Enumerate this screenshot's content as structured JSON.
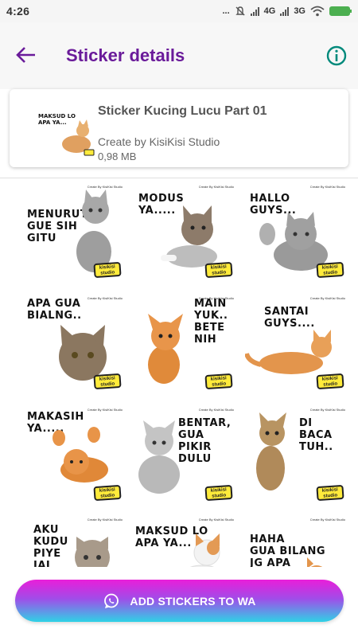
{
  "status_bar": {
    "time": "4:26",
    "dots": "...",
    "network_1": "4G",
    "network_2": "3G",
    "icons": [
      "dots-icon",
      "mute-icon",
      "signal-icon",
      "signal-icon",
      "wifi-icon",
      "battery-icon"
    ]
  },
  "app_bar": {
    "title": "Sticker details",
    "back_icon": "arrow-left-icon",
    "info_icon": "info-icon",
    "accent": "#6a1b9a",
    "info_color": "#00897b"
  },
  "pack": {
    "name": "Sticker Kucing Lucu Part 01",
    "author": "Create by KisiKisi Studio",
    "size": "0,98 MB",
    "tray_caption": "MAKSUD LO\nAPA YA..."
  },
  "stickers": [
    {
      "caption": "MENURUT\nGUE SIH\nGITU",
      "credit": "Create By KisiKisi Studio",
      "badge": "kisikisi\nstudio"
    },
    {
      "caption": "MODUS\nYA.....",
      "credit": "Create By KisiKisi Studio",
      "badge": "kisikisi\nstudio"
    },
    {
      "caption": "HALLO\nGUYS...",
      "credit": "Create By KisiKisi Studio",
      "badge": "kisikisi\nstudio"
    },
    {
      "caption": "APA GUA\nBIALNG..",
      "credit": "Create By KisiKisi Studio",
      "badge": "kisikisi\nstudio"
    },
    {
      "caption": "MAIN\nYUK..\nBETE\nNIH",
      "credit": "Create By KisiKisi Studio",
      "badge": "kisikisi\nstudio"
    },
    {
      "caption": "SANTAI\nGUYS....",
      "credit": "Create By KisiKisi Studio",
      "badge": "kisikisi\nstudio"
    },
    {
      "caption": "MAKASIH\nYA.....",
      "credit": "Create By KisiKisi Studio",
      "badge": "kisikisi\nstudio"
    },
    {
      "caption": "BENTAR,\nGUA PIKIR\nDULU",
      "credit": "Create By KisiKisi Studio",
      "badge": "kisikisi\nstudio"
    },
    {
      "caption": "DI\nBACA\nTUH..",
      "credit": "Create By KisiKisi Studio",
      "badge": "kisikisi\nstudio"
    },
    {
      "caption": "AKU\nKUDU\nPIYE\nJAL",
      "credit": "Create By KisiKisi Studio",
      "badge": ""
    },
    {
      "caption": "MAKSUD LO\nAPA YA...",
      "credit": "Create By KisiKisi Studio",
      "badge": ""
    },
    {
      "caption": "HAHA\nGUA BILANG\nJG APA",
      "credit": "Create By KisiKisi Studio",
      "badge": ""
    }
  ],
  "add_button": {
    "label": "ADD STICKERS TO WA",
    "icon": "whatsapp-icon"
  }
}
